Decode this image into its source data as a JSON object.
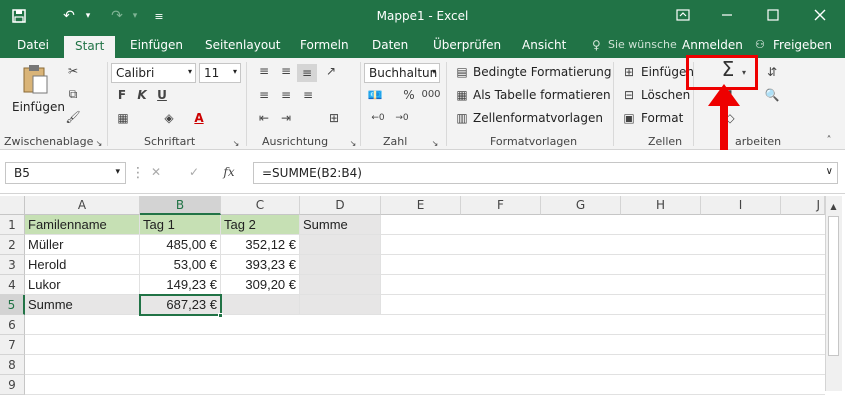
{
  "window": {
    "title": "Mappe1 - Excel"
  },
  "tabs": [
    "Datei",
    "Start",
    "Einfügen",
    "Seitenlayout",
    "Formeln",
    "Daten",
    "Überprüfen",
    "Ansicht"
  ],
  "tell_me": "Sie wünsche",
  "signin": "Anmelden",
  "share": "Freigeben",
  "ribbon": {
    "paste": "Einfügen",
    "font_name": "Calibri",
    "font_size": "11",
    "bold": "F",
    "italic": "K",
    "underline": "U",
    "number_format": "Buchhaltun",
    "percent": "%",
    "thousands": "000",
    "cond_format": "Bedingte Formatierung",
    "table_format": "Als Tabelle formatieren",
    "cell_styles": "Zellenformatvorlagen",
    "insert": "Einfügen",
    "delete": "Löschen",
    "format": "Format",
    "sum": "Σ",
    "groups": {
      "clipboard": "Zwischenablage",
      "font": "Schriftart",
      "alignment": "Ausrichtung",
      "number": "Zahl",
      "styles": "Formatvorlagen",
      "cells": "Zellen",
      "editing": "arbeiten"
    }
  },
  "formula": {
    "name_box": "B5",
    "fx": "fx",
    "content": "=SUMME(B2:B4)"
  },
  "columns": [
    "A",
    "B",
    "C",
    "D",
    "E",
    "F",
    "G",
    "H",
    "I",
    "J"
  ],
  "rows": [
    "1",
    "2",
    "3",
    "4",
    "5",
    "6",
    "7",
    "8",
    "9"
  ],
  "cells": {
    "A1": "Familenname",
    "B1": "Tag 1",
    "C1": "Tag 2",
    "D1": "Summe",
    "A2": "Müller",
    "B2": "485,00 €",
    "C2": "352,12 €",
    "A3": "Herold",
    "B3": "53,00 €",
    "C3": "393,23 €",
    "A4": "Lukor",
    "B4": "149,23 €",
    "C4": "309,20 €",
    "A5": "Summe",
    "B5": "687,23 €"
  },
  "colors": {
    "excel_green": "#217346",
    "header_fill": "#c6e0b4",
    "gray_fill": "#e7e6e6",
    "highlight": "#e00000"
  }
}
